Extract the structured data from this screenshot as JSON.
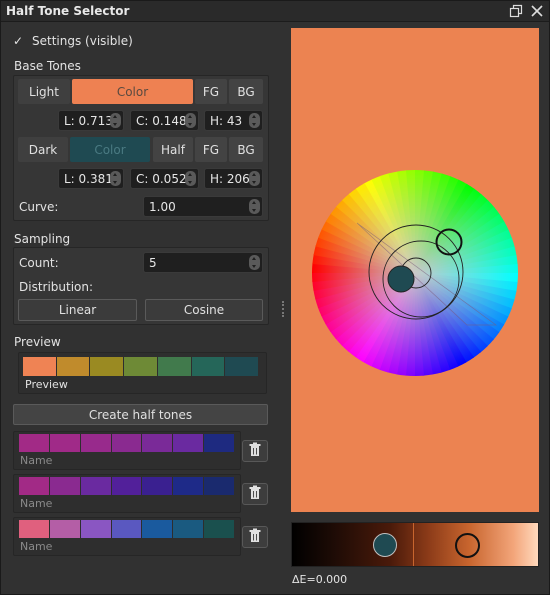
{
  "window": {
    "title": "Half Tone Selector"
  },
  "settings": {
    "check_mark": "✓",
    "label": "Settings (visible)"
  },
  "base_tones": {
    "heading": "Base Tones",
    "light": {
      "label": "Light",
      "color_label": "Color",
      "color": "#ee8152",
      "fg": "FG",
      "bg": "BG",
      "l": "L: 0.713",
      "c": "C: 0.148",
      "h": "H: 43"
    },
    "dark": {
      "label": "Dark",
      "color_label": "Color",
      "color": "#1f4a52",
      "half": "Half",
      "fg": "FG",
      "bg": "BG",
      "l": "L: 0.381",
      "c": "C: 0.052",
      "h": "H: 206"
    },
    "curve_label": "Curve:",
    "curve_value": "1.00"
  },
  "sampling": {
    "heading": "Sampling",
    "count_label": "Count:",
    "count_value": "5",
    "distribution_label": "Distribution:",
    "linear": "Linear",
    "cosine": "Cosine"
  },
  "preview": {
    "heading": "Preview",
    "swatches": [
      "#ef8354",
      "#c08b2c",
      "#9a8a22",
      "#6e8a36",
      "#417a4c",
      "#256659",
      "#1f4a52"
    ],
    "caption": "Preview"
  },
  "create_button": "Create half tones",
  "palettes": [
    {
      "name": "Name",
      "swatches": [
        "#a22a86",
        "#a02a88",
        "#982a8c",
        "#8a2a90",
        "#7a2a98",
        "#6a2aa0",
        "#1e2a80"
      ]
    },
    {
      "name": "Name",
      "swatches": [
        "#a22a86",
        "#8a2a90",
        "#6a2aa0",
        "#52209a",
        "#3a2090",
        "#1e2a88",
        "#1a2a6e"
      ]
    },
    {
      "name": "Name",
      "swatches": [
        "#e0607e",
        "#b45ea6",
        "#8a56c2",
        "#5a58c0",
        "#1a5a9e",
        "#1a5a80",
        "#1a504e"
      ]
    }
  ],
  "canvas_bg": "#ec8351",
  "delta_e": "ΔE=0.000"
}
